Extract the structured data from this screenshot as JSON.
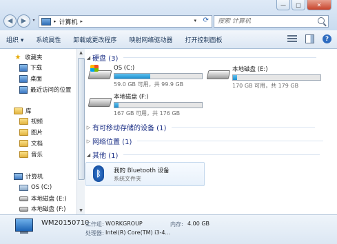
{
  "window": {
    "minimize": "—",
    "maximize": "□",
    "close": "✕"
  },
  "address": {
    "path": "计算机",
    "drop": "▾",
    "sep": "▸"
  },
  "search": {
    "placeholder": "搜索 计算机"
  },
  "toolbar": {
    "items": [
      "组织 ▾",
      "系统属性",
      "卸载或更改程序",
      "映射网络驱动器",
      "打开控制面板"
    ],
    "help": "?"
  },
  "nav": {
    "favorites": "收藏夹",
    "downloads": "下载",
    "desktop": "桌面",
    "recent": "最近访问的位置",
    "library": "库",
    "videos": "视频",
    "pictures": "图片",
    "documents": "文档",
    "music": "音乐",
    "computer": "计算机",
    "os": "OS (C:)",
    "local_e": "本地磁盘 (E:)",
    "local_f": "本地磁盘 (F:)"
  },
  "groups": {
    "hard_disks": "硬盘 (3)",
    "removable": "有可移动存储的设备 (1)",
    "network": "网络位置 (1)",
    "other": "其他 (1)"
  },
  "drives": [
    {
      "name": "OS (C:)",
      "free": "59.0 GB 可用，共 99.9 GB",
      "fill_pct": 41
    },
    {
      "name": "本地磁盘 (E:)",
      "free": "170 GB 可用，共 179 GB",
      "fill_pct": 5
    },
    {
      "name": "本地磁盘 (F:)",
      "free": "167 GB 可用，共 176 GB",
      "fill_pct": 5
    }
  ],
  "bluetooth": {
    "name": "我的 Bluetooth 设备",
    "type": "系统文件夹",
    "glyph": "ᛒ"
  },
  "details": {
    "computer_name": "WM20150710",
    "workgroup_label": "工作组:",
    "workgroup_value": "WORKGROUP",
    "memory_label": "内存:",
    "memory_value": "4.00 GB",
    "cpu_label": "处理器:",
    "cpu_value": "Intel(R) Core(TM) i3-4..."
  },
  "colors": {
    "accent": "#1d8fd0",
    "group_text": "#1e3287"
  }
}
